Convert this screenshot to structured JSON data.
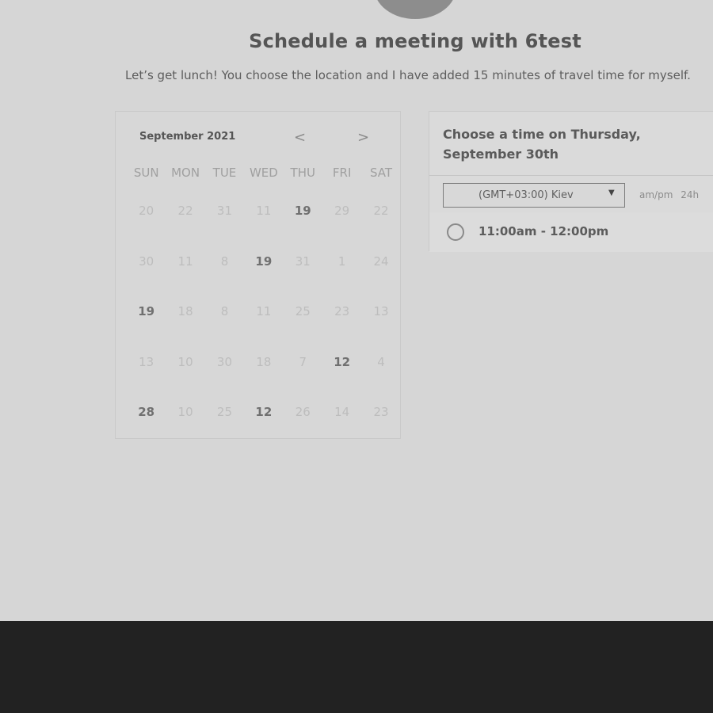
{
  "page": {
    "title": "Schedule a meeting with 6test",
    "subtitle": "Let’s get lunch! You choose the location and I have added 15 minutes of travel time for myself."
  },
  "calendar": {
    "month_label": "September 2021",
    "prev_icon": "chevron-left-icon",
    "next_icon": "chevron-right-icon",
    "prev_glyph": "<",
    "next_glyph": ">",
    "weekdays": [
      "SUN",
      "MON",
      "TUE",
      "WED",
      "THU",
      "FRI",
      "SAT"
    ],
    "weeks": [
      [
        {
          "n": "20",
          "on": false
        },
        {
          "n": "22",
          "on": false
        },
        {
          "n": "31",
          "on": false
        },
        {
          "n": "11",
          "on": false
        },
        {
          "n": "19",
          "on": true
        },
        {
          "n": "29",
          "on": false
        },
        {
          "n": "22",
          "on": false
        }
      ],
      [
        {
          "n": "30",
          "on": false
        },
        {
          "n": "11",
          "on": false
        },
        {
          "n": "8",
          "on": false
        },
        {
          "n": "19",
          "on": true
        },
        {
          "n": "31",
          "on": false
        },
        {
          "n": "1",
          "on": false
        },
        {
          "n": "24",
          "on": false
        }
      ],
      [
        {
          "n": "19",
          "on": true
        },
        {
          "n": "18",
          "on": false
        },
        {
          "n": "8",
          "on": false
        },
        {
          "n": "11",
          "on": false
        },
        {
          "n": "25",
          "on": false
        },
        {
          "n": "23",
          "on": false
        },
        {
          "n": "13",
          "on": false
        }
      ],
      [
        {
          "n": "13",
          "on": false
        },
        {
          "n": "10",
          "on": false
        },
        {
          "n": "30",
          "on": false
        },
        {
          "n": "18",
          "on": false
        },
        {
          "n": "7",
          "on": false
        },
        {
          "n": "12",
          "on": true
        },
        {
          "n": "4",
          "on": false
        }
      ],
      [
        {
          "n": "28",
          "on": true
        },
        {
          "n": "10",
          "on": false
        },
        {
          "n": "25",
          "on": false
        },
        {
          "n": "12",
          "on": true
        },
        {
          "n": "26",
          "on": false
        },
        {
          "n": "14",
          "on": false
        },
        {
          "n": "23",
          "on": false
        }
      ]
    ]
  },
  "panel": {
    "heading": "Choose a time on Thursday, September 30th",
    "timezone": "(GMT+03:00) Kiev",
    "caret_glyph": "▼",
    "format_ampm": "am/pm",
    "format_24h": "24h",
    "slots": [
      "11:00am - 12:00pm"
    ]
  }
}
